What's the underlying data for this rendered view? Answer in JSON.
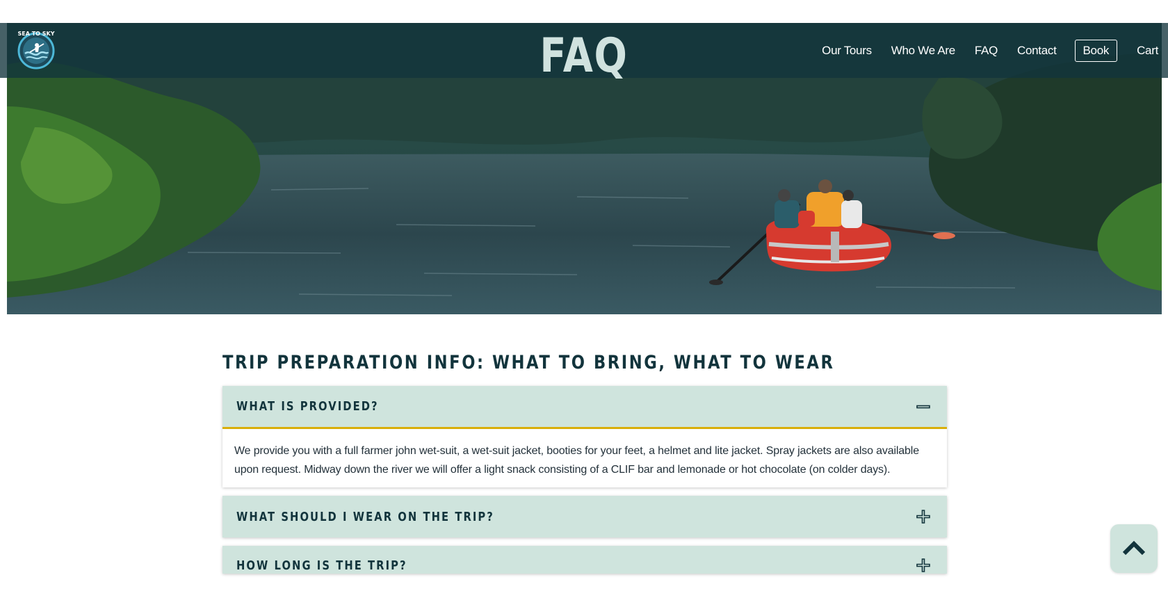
{
  "hero": {
    "title": "FAQ"
  },
  "nav": {
    "logo_text": "SEA TO SKY",
    "links": [
      "Our Tours",
      "Who We Are",
      "FAQ",
      "Contact"
    ],
    "book_label": "Book",
    "cart_label": "Cart"
  },
  "section": {
    "title": "TRIP PREPARATION INFO: WHAT TO BRING, WHAT TO WEAR"
  },
  "faq": [
    {
      "question": "WHAT IS PROVIDED?",
      "state": "expanded",
      "answer": "We provide you with a full farmer john wet-suit, a wet-suit jacket, booties for your feet, a helmet and lite jacket. Spray jackets are also available upon request. Midway down the river we will offer a light snack consisting of a CLIF bar and lemonade or hot chocolate (on colder days)."
    },
    {
      "question": "WHAT SHOULD I WEAR ON THE TRIP?",
      "state": "collapsed"
    },
    {
      "question": "HOW LONG IS THE TRIP?",
      "state": "collapsed"
    }
  ],
  "colors": {
    "nav_bg": "#12343c",
    "accordion_bg": "#cfe4dd",
    "accent_underline": "#d9ae0a",
    "heading_text": "#12343c"
  },
  "icons": {
    "expanded": "minus-icon",
    "collapsed": "plus-icon",
    "scroll_top": "chevron-up-icon"
  }
}
